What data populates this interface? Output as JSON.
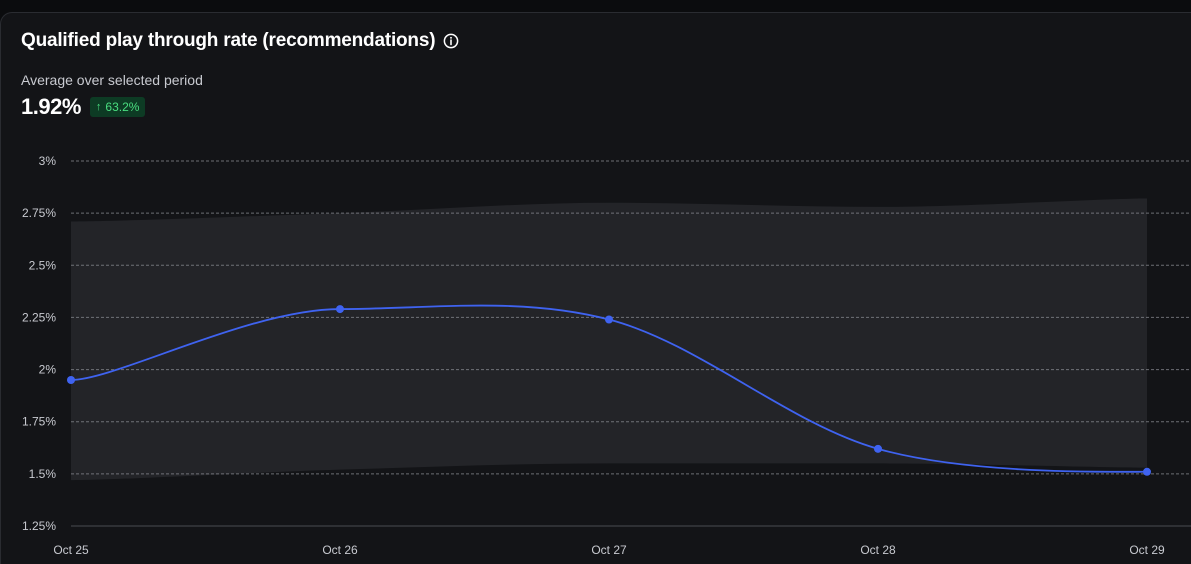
{
  "header": {
    "title": "Qualified play through rate (recommendations)",
    "subtitle": "Average over selected period",
    "metric_value": "1.92%",
    "delta": "63.2%",
    "delta_arrow": "↑"
  },
  "colors": {
    "line": "#3f63f0",
    "band": "#232428",
    "delta_bg": "#0d3b24",
    "delta_text": "#4ade80",
    "grid": "#8a8c92"
  },
  "chart_data": {
    "type": "line",
    "categories": [
      "Oct 25",
      "Oct 26",
      "Oct 27",
      "Oct 28",
      "Oct 29"
    ],
    "series": [
      {
        "values": [
          1.95,
          2.29,
          2.24,
          1.62,
          1.51
        ]
      }
    ],
    "band": {
      "upper": [
        2.71,
        2.75,
        2.8,
        2.78,
        2.82
      ],
      "lower": [
        1.47,
        1.52,
        1.55,
        1.55,
        1.53
      ]
    },
    "yticks": [
      "3%",
      "2.75%",
      "2.5%",
      "2.25%",
      "2%",
      "1.75%",
      "1.5%",
      "1.25%"
    ],
    "ytick_values": [
      3,
      2.75,
      2.5,
      2.25,
      2,
      1.75,
      1.5,
      1.25
    ],
    "ylim": [
      1.25,
      3
    ],
    "grid": true
  }
}
